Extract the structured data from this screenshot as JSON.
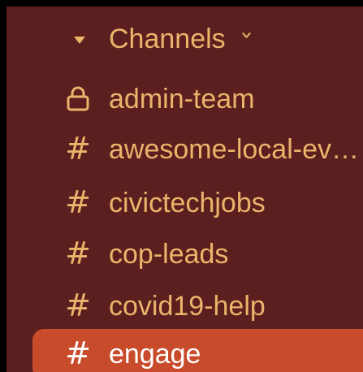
{
  "sidebar": {
    "section": {
      "title": "Channels",
      "collapse_icon": "caret-down-icon",
      "menu_icon": "chevron-down-icon"
    },
    "channels": [
      {
        "name": "admin-team",
        "icon": "lock-icon",
        "private": true
      },
      {
        "name": "awesome-local-ev…",
        "icon": "hash-icon"
      },
      {
        "name": "civictechjobs",
        "icon": "hash-icon"
      },
      {
        "name": "cop-leads",
        "icon": "hash-icon"
      },
      {
        "name": "covid19-help",
        "icon": "hash-icon"
      },
      {
        "name": "engage",
        "icon": "hash-icon",
        "selected": true
      }
    ],
    "hash_glyph": "#"
  },
  "colors": {
    "sidebar_bg": "#5b1f1f",
    "text": "#e8b56b",
    "active_bg": "#c84b2b",
    "active_text": "#ffffff",
    "border": "#000000"
  }
}
